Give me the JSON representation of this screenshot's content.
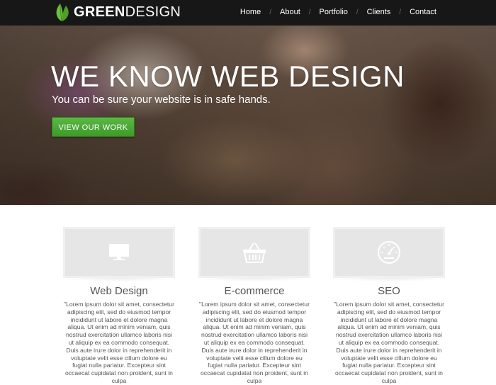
{
  "brand": {
    "logo_bold": "GREEN",
    "logo_light": "DESIGN"
  },
  "nav": {
    "items": [
      "Home",
      "About",
      "Portfolio",
      "Clients",
      "Contact"
    ],
    "separator": "/"
  },
  "hero": {
    "title": "WE KNOW WEB DESIGN",
    "subtitle": "You can be sure your website is in safe hands.",
    "cta_label": "VIEW OUR WORK"
  },
  "features": [
    {
      "icon": "monitor-icon",
      "title": "Web Design",
      "text": "\"Lorem ipsum dolor sit amet, consectetur adipiscing elit, sed do eiusmod tempor incididunt ut labore et dolore magna aliqua. Ut enim ad minim veniam, quis nostrud exercitation ullamco laboris nisi ut aliquip ex ea commodo consequat. Duis aute irure dolor in reprehenderit in voluptate velit esse cillum dolore eu fugiat nulla pariatur. Excepteur sint occaecat cupidatat non proident, sunt in culpa"
    },
    {
      "icon": "shopping-basket-icon",
      "title": "E-commerce",
      "text": "\"Lorem ipsum dolor sit amet, consectetur adipiscing elit, sed do eiusmod tempor incididunt ut labore et dolore magna aliqua. Ut enim ad minim veniam, quis nostrud exercitation ullamco laboris nisi ut aliquip ex ea commodo consequat. Duis aute irure dolor in reprehenderit in voluptate velit esse cillum dolore eu fugiat nulla pariatur. Excepteur sint occaecat cupidatat non proident, sunt in culpa"
    },
    {
      "icon": "speedometer-icon",
      "title": "SEO",
      "text": "\"Lorem ipsum dolor sit amet, consectetur adipiscing elit, sed do eiusmod tempor incididunt ut labore et dolore magna aliqua. Ut enim ad minim veniam, quis nostrud exercitation ullamco laboris nisi ut aliquip ex ea commodo consequat. Duis aute irure dolor in reprehenderit in voluptate velit esse cillum dolore eu fugiat nulla pariatur. Excepteur sint occaecat cupidatat non proident, sunt in culpa"
    }
  ],
  "colors": {
    "header_bg": "#171717",
    "brand_green": "#6cbf3b",
    "cta_green": "#4aa832",
    "card_bg": "#e6e6e6"
  }
}
